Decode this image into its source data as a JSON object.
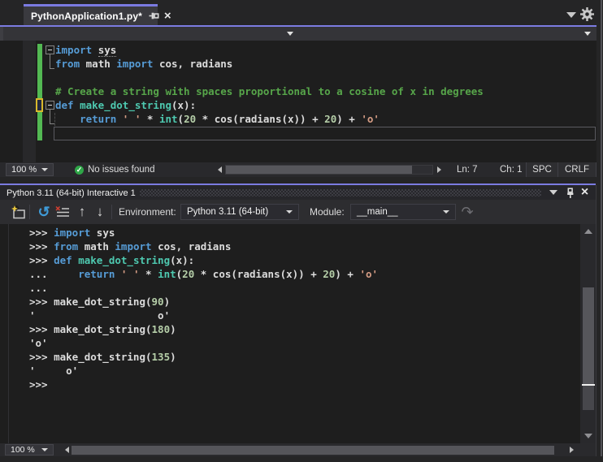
{
  "colors": {
    "accent_purple": "#7b7be1",
    "editor_bg": "#1e1e1e",
    "chrome_bg": "#252526",
    "keyword": "#569cd6",
    "type_function": "#4ec9b0",
    "string": "#d69d85",
    "number": "#b5cea8",
    "comment": "#57a64a",
    "plain_text": "#dcdcdc",
    "change_saved_green": "#53b953",
    "change_unsaved_yellow": "#d9b82c",
    "check_green": "#2fa648"
  },
  "tab": {
    "title": "PythonApplication1.py*"
  },
  "top_icons": {
    "tab_list": "chevron-down",
    "settings": "gear"
  },
  "editor": {
    "lines": [
      [
        {
          "t": "import ",
          "c": "k"
        },
        {
          "t": "sys",
          "c": "p",
          "u": 1
        }
      ],
      [
        {
          "t": "from ",
          "c": "k"
        },
        {
          "t": "math ",
          "c": "p"
        },
        {
          "t": "import ",
          "c": "k"
        },
        {
          "t": "cos, radians",
          "c": "p"
        }
      ],
      [],
      [
        {
          "t": "# Create a string with spaces proportional to a cosine of x in degrees",
          "c": "c"
        }
      ],
      [
        {
          "t": "def ",
          "c": "k"
        },
        {
          "t": "make_dot_string",
          "c": "f"
        },
        {
          "t": "(x):",
          "c": "p"
        }
      ],
      [
        {
          "t": "    ",
          "c": "p"
        },
        {
          "t": "return ",
          "c": "k"
        },
        {
          "t": "' '",
          "c": "s"
        },
        {
          "t": " * ",
          "c": "p"
        },
        {
          "t": "int",
          "c": "f"
        },
        {
          "t": "(",
          "c": "p"
        },
        {
          "t": "20",
          "c": "n"
        },
        {
          "t": " * cos(radians(x)) + ",
          "c": "p"
        },
        {
          "t": "20",
          "c": "n"
        },
        {
          "t": ") + ",
          "c": "p"
        },
        {
          "t": "'o'",
          "c": "s"
        }
      ],
      []
    ]
  },
  "editor_bar": {
    "zoom": "100 %",
    "issues": "No issues found",
    "line": "Ln: 7",
    "column": "Ch: 1",
    "insert_mode": "SPC",
    "line_ending": "CRLF"
  },
  "interactive": {
    "title": "Python 3.11 (64-bit) Interactive 1",
    "toolbar": {
      "environment_label": "Environment:",
      "environment_value": "Python 3.11 (64-bit)",
      "module_label": "Module:",
      "module_value": "__main__"
    },
    "lines": [
      [
        {
          "t": ">>> ",
          "c": "p"
        },
        {
          "t": "import ",
          "c": "k"
        },
        {
          "t": "sys",
          "c": "p"
        }
      ],
      [
        {
          "t": ">>> ",
          "c": "p"
        },
        {
          "t": "from ",
          "c": "k"
        },
        {
          "t": "math ",
          "c": "p"
        },
        {
          "t": "import ",
          "c": "k"
        },
        {
          "t": "cos, radians",
          "c": "p"
        }
      ],
      [
        {
          "t": ">>> ",
          "c": "p"
        },
        {
          "t": "def ",
          "c": "k"
        },
        {
          "t": "make_dot_string",
          "c": "f"
        },
        {
          "t": "(x):",
          "c": "p"
        }
      ],
      [
        {
          "t": "...     ",
          "c": "p"
        },
        {
          "t": "return ",
          "c": "k"
        },
        {
          "t": "' '",
          "c": "s"
        },
        {
          "t": " * ",
          "c": "p"
        },
        {
          "t": "int",
          "c": "f"
        },
        {
          "t": "(",
          "c": "p"
        },
        {
          "t": "20",
          "c": "n"
        },
        {
          "t": " * cos(radians(x)) + ",
          "c": "p"
        },
        {
          "t": "20",
          "c": "n"
        },
        {
          "t": ") + ",
          "c": "p"
        },
        {
          "t": "'o'",
          "c": "s"
        }
      ],
      [
        {
          "t": "...",
          "c": "p"
        }
      ],
      [
        {
          "t": ">>> make_dot_string(",
          "c": "p"
        },
        {
          "t": "90",
          "c": "n"
        },
        {
          "t": ")",
          "c": "p"
        }
      ],
      [
        {
          "t": "'                    o'",
          "c": "p"
        }
      ],
      [
        {
          "t": ">>> make_dot_string(",
          "c": "p"
        },
        {
          "t": "180",
          "c": "n"
        },
        {
          "t": ")",
          "c": "p"
        }
      ],
      [
        {
          "t": "'o'",
          "c": "p"
        }
      ],
      [
        {
          "t": ">>> make_dot_string(",
          "c": "p"
        },
        {
          "t": "135",
          "c": "n"
        },
        {
          "t": ")",
          "c": "p"
        }
      ],
      [
        {
          "t": "'     o'",
          "c": "p"
        }
      ],
      [
        {
          "t": ">>>",
          "c": "p"
        }
      ]
    ],
    "zoom": "100 %"
  }
}
